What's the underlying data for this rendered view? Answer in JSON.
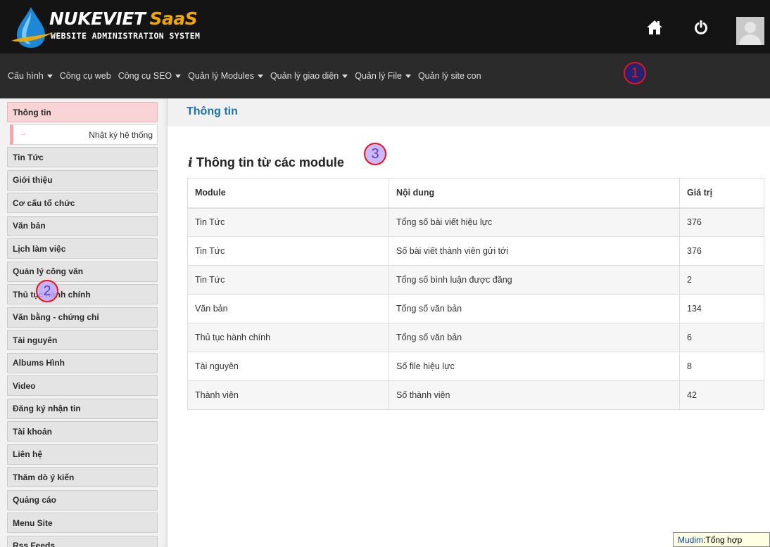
{
  "header": {
    "logo_brand": "NUKEVIET",
    "logo_brand_accent": "SaaS",
    "logo_subtitle": "WEBSITE ADMINISTRATION SYSTEM"
  },
  "nav": {
    "items": [
      {
        "label": "Cấu hình",
        "dropdown": true
      },
      {
        "label": "Công cụ web",
        "dropdown": false
      },
      {
        "label": "Công cụ SEO",
        "dropdown": true
      },
      {
        "label": "Quản lý Modules",
        "dropdown": true
      },
      {
        "label": "Quản lý giao diện",
        "dropdown": true
      },
      {
        "label": "Quản lý File",
        "dropdown": true
      },
      {
        "label": "Quản lý site con",
        "dropdown": false
      }
    ]
  },
  "markers": [
    "1",
    "2",
    "3"
  ],
  "sidebar": {
    "active": "Thông tin",
    "sub_item": "Nhật ký hệ thống",
    "items": [
      "Tin Tức",
      "Giới thiệu",
      "Cơ cấu tổ chức",
      "Văn bản",
      "Lịch làm việc",
      "Quản lý công văn",
      "Thủ tục hành chính",
      "Văn bằng - chứng chỉ",
      "Tài nguyên",
      "Albums Hình",
      "Video",
      "Đăng ký nhận tin",
      "Tài khoản",
      "Liên hệ",
      "Thăm dò ý kiến",
      "Quảng cáo",
      "Menu Site",
      "Rss Feeds"
    ]
  },
  "main": {
    "page_title": "Thông tin",
    "section_title": "Thông tin từ các module",
    "table": {
      "headers": [
        "Module",
        "Nội dung",
        "Giá trị"
      ],
      "rows": [
        [
          "Tin Tức",
          "Tổng số bài viết hiệu lực",
          "376"
        ],
        [
          "Tin Tức",
          "Số bài viết thành viên gửi tới",
          "376"
        ],
        [
          "Tin Tức",
          "Tổng số bình luận được đăng",
          "2"
        ],
        [
          "Văn bản",
          "Tổng số văn bản",
          "134"
        ],
        [
          "Thủ tục hành chính",
          "Tổng số văn bản",
          "6"
        ],
        [
          "Tài nguyên",
          "Số file hiệu lực",
          "8"
        ],
        [
          "Thành viên",
          "Số thành viên",
          "42"
        ]
      ]
    }
  },
  "mudim": {
    "brand": "Mudim",
    "mode": "Tổng hợp"
  },
  "colors": {
    "accent_blue": "#1f73a8",
    "active_pink": "#f9d4d6",
    "marker_red": "#e8131c"
  }
}
